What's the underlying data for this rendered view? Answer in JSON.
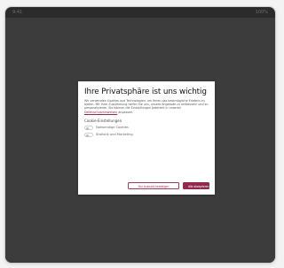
{
  "topbar": {
    "left_text": "9:41",
    "right_text": "100%"
  },
  "dialog": {
    "title": "Ihre Privatsphäre ist uns wichtig",
    "body_intro": "Wir verwenden Cookies und Technologien, um Ihnen das bestmögliche Erlebnis zu bieten. Mit Ihrer Zustimmung helfen Sie uns, unsere Angebote zu verbessern und zu personalisieren. Sie können die Einstellungen jederzeit in unseren",
    "link_text": "Datenschutzhinweisen",
    "body_outro": "anpassen.",
    "section_label": "Cookie-Einstellungen",
    "toggles": [
      {
        "label": "Notwendige Cookies"
      },
      {
        "label": "Statistik und Marketing"
      }
    ],
    "buttons": {
      "secondary": "Nur Auswahl bestätigen",
      "primary": "Alle akzeptieren"
    }
  },
  "colors": {
    "overlay": "#404040",
    "accent": "#8f2a4e"
  },
  "icons": {
    "toggle_off": "toggle-icon"
  }
}
